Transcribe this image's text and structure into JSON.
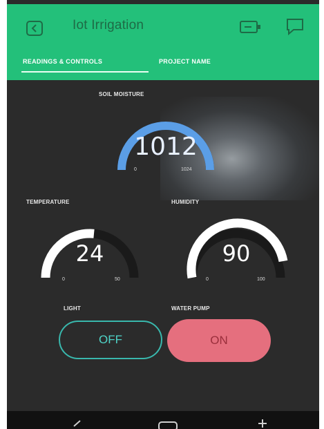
{
  "app": {
    "title": "Iot Irrigation"
  },
  "tabs": [
    {
      "label": "READINGS & CONTROLS",
      "active": true
    },
    {
      "label": "PROJECT NAME",
      "active": false
    }
  ],
  "gauges": {
    "soil": {
      "label": "SOIL MOISTURE",
      "value": "1012",
      "min": "0",
      "max": "1024",
      "color": "#5b9ee6"
    },
    "temperature": {
      "label": "TEMPERATURE",
      "value": "24",
      "min": "0",
      "max": "50",
      "color": "#ffffff"
    },
    "humidity": {
      "label": "HUMIDITY",
      "value": "90",
      "min": "0",
      "max": "100",
      "color": "#ffffff"
    }
  },
  "controls": {
    "light": {
      "label": "LIGHT",
      "state": "OFF",
      "color": "#39b8ad"
    },
    "pump": {
      "label": "WATER PUMP",
      "state": "ON",
      "color": "#e56f7e"
    }
  },
  "colors": {
    "appbar": "#23c07a",
    "background": "#2b2b2b",
    "gauge_track": "#1a1a1a"
  },
  "icons": [
    "back-icon",
    "battery-icon",
    "chat-icon"
  ]
}
